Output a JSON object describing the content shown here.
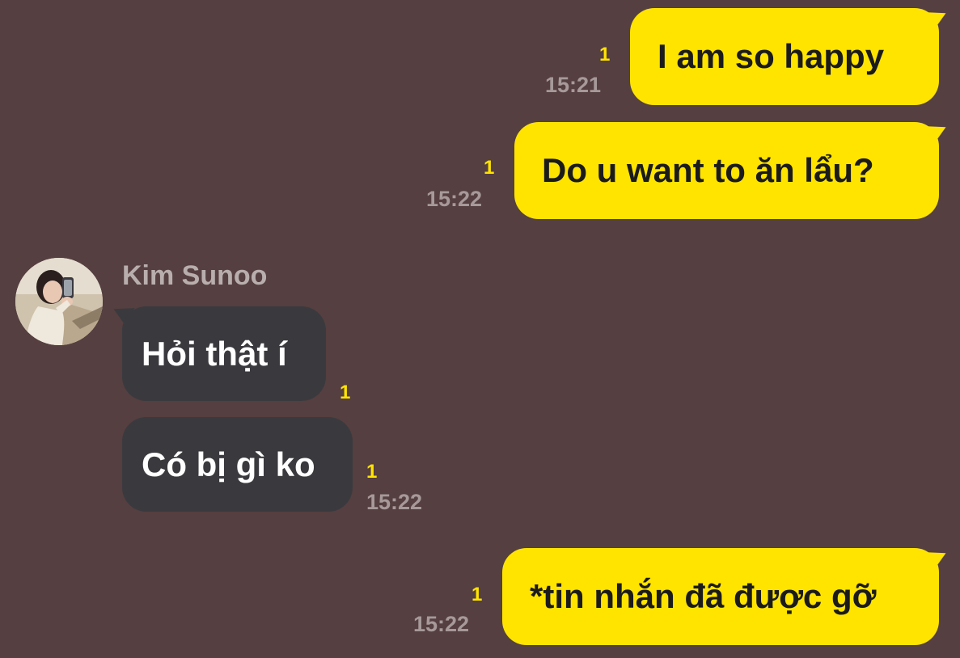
{
  "chat": {
    "messages": [
      {
        "direction": "outgoing",
        "text": "I am so happy",
        "unread": "1",
        "time": "15:21"
      },
      {
        "direction": "outgoing",
        "text": "Do u want to ăn lẩu?",
        "unread": "1",
        "time": "15:22"
      },
      {
        "direction": "incoming",
        "sender": "Kim Sunoo",
        "text": "Hỏi thật í",
        "unread": "1",
        "time": ""
      },
      {
        "direction": "incoming",
        "text": "Có bị gì ko",
        "unread": "1",
        "time": "15:22"
      },
      {
        "direction": "outgoing",
        "text": "*tin nhắn đã được gỡ",
        "unread": "1",
        "time": "15:22"
      }
    ]
  },
  "colors": {
    "background": "#553f40",
    "outgoing_bubble": "#ffe400",
    "incoming_bubble": "#3a3a3e",
    "unread_count": "#ffe400",
    "timestamp": "#a7999a"
  }
}
